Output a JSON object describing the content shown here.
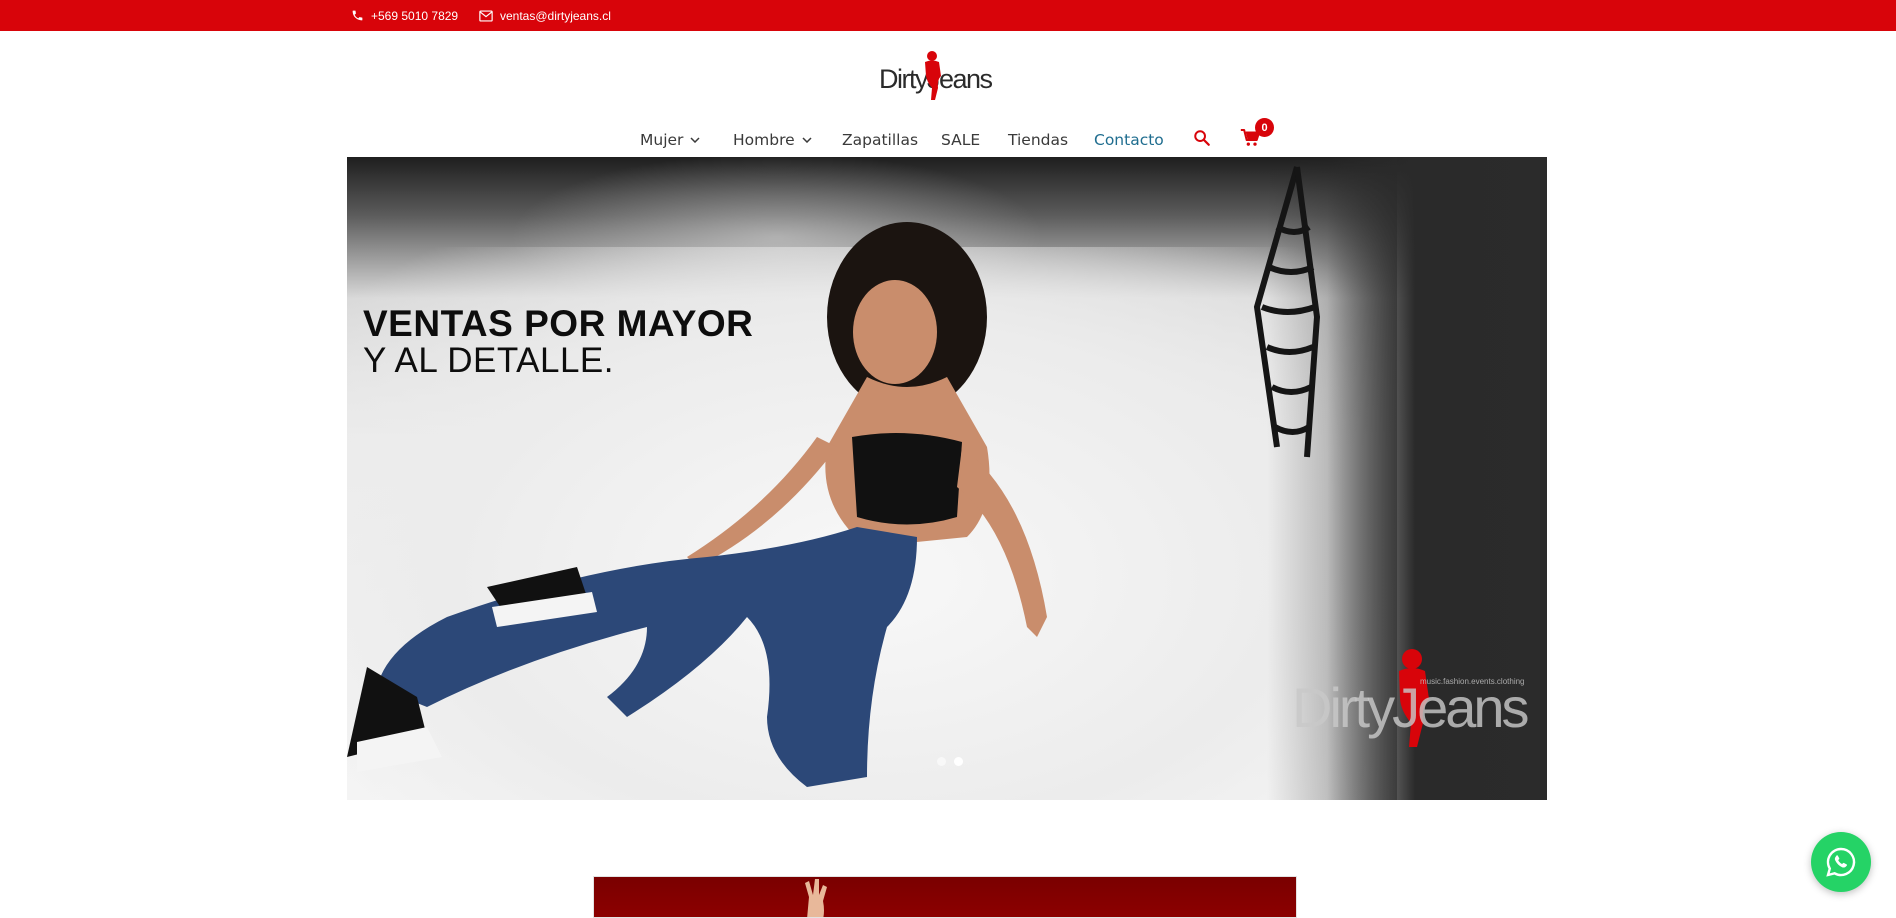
{
  "topbar": {
    "background": "#d8040a",
    "phone": "+569 5010 7829",
    "email": "ventas@dirtyjeans.cl",
    "phone_icon": "phone-icon",
    "email_icon": "envelope-icon"
  },
  "logo": {
    "text": "DirtyJeans",
    "accent": "#d8040a"
  },
  "nav": {
    "items": [
      {
        "label": "Mujer",
        "has_dropdown": true
      },
      {
        "label": "Hombre",
        "has_dropdown": true
      },
      {
        "label": "Zapatillas",
        "has_dropdown": false
      },
      {
        "label": "SALE",
        "has_dropdown": false
      },
      {
        "label": "Tiendas",
        "has_dropdown": false
      },
      {
        "label": "Contacto",
        "has_dropdown": false,
        "active": true
      }
    ],
    "search_icon": "search-icon",
    "cart_icon": "cart-icon",
    "cart_count": "0",
    "active_color": "#1f6d8f"
  },
  "hero": {
    "headline_line1": "VENTAS POR MAYOR",
    "headline_line2": "Y AL DETALLE.",
    "watermark_text": "DirtyJeans",
    "watermark_tagline": "music.fashion.events.clothing",
    "slides_total": 2,
    "active_slide": 2
  },
  "whatsapp": {
    "icon": "whatsapp-icon",
    "color": "#25d366"
  }
}
